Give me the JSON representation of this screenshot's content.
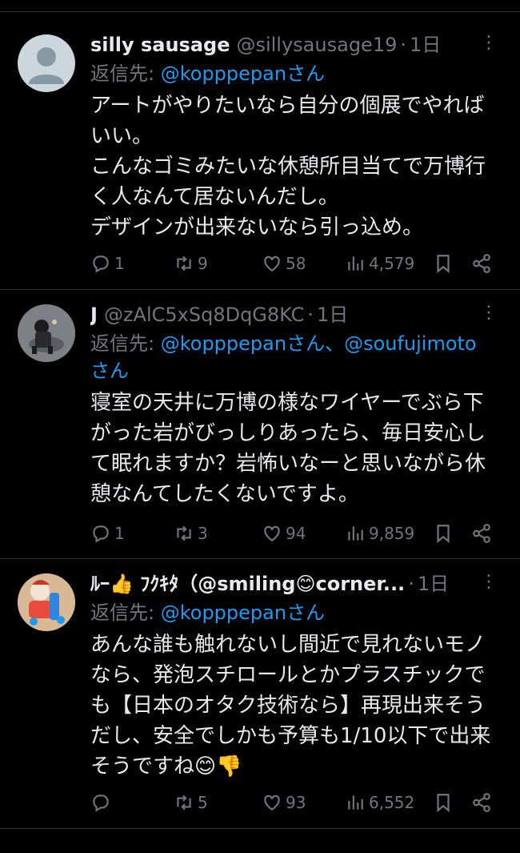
{
  "tweets": [
    {
      "name": "silly sausage",
      "handle": "@sillysausage19",
      "time": "1日",
      "reply_prefix": "返信先: ",
      "mentions": "@kopppepanさん",
      "body": "アートがやりたいなら自分の個展でやれば\nいい。\nこんなゴミみたいな休憩所目当てで万博行\nく人なんて居ないんだし。\nデザインが出来ないなら引っ込め。",
      "replies": "1",
      "retweets": "9",
      "likes": "58",
      "views": "4,579"
    },
    {
      "name": "J",
      "handle": "@zAlC5xSq8DqG8KC",
      "time": "1日",
      "reply_prefix": "返信先: ",
      "mentions": "@kopppepanさん、@soufujimoto\nさん",
      "body": "寝室の天井に万博の様なワイヤーでぶら下\nがった岩がびっしりあったら、毎日安心し\nて眠れますか？岩怖いなーと思いながら休\n憩なんてしたくないですよ。",
      "replies": "1",
      "retweets": "3",
      "likes": "94",
      "views": "9,859"
    },
    {
      "name": "ﾙｰ👍 ﾌｸｷﾀ（@smiling😊corner...",
      "handle": "",
      "time": "1日",
      "reply_prefix": "返信先: ",
      "mentions": "@kopppepanさん",
      "body": "あんな誰も触れないし間近で見れないモノ\nなら、発泡スチロールとかプラスチックで\nも【日本のオタク技術なら】再現出来そう\nだし、安全でしかも予算も1/10以下で出来\nそうですね😊👎",
      "replies": "",
      "retweets": "5",
      "likes": "93",
      "views": "6,552"
    }
  ],
  "icons": {
    "reply": "reply-icon",
    "retweet": "retweet-icon",
    "like": "heart-icon",
    "views": "views-icon",
    "bookmark": "bookmark-icon",
    "share": "share-icon",
    "more": "more-icon"
  },
  "colors": {
    "background": "#000000",
    "text": "#e7e9ea",
    "muted": "#71767b",
    "link": "#1d9bf0",
    "divider": "#2f3336"
  }
}
